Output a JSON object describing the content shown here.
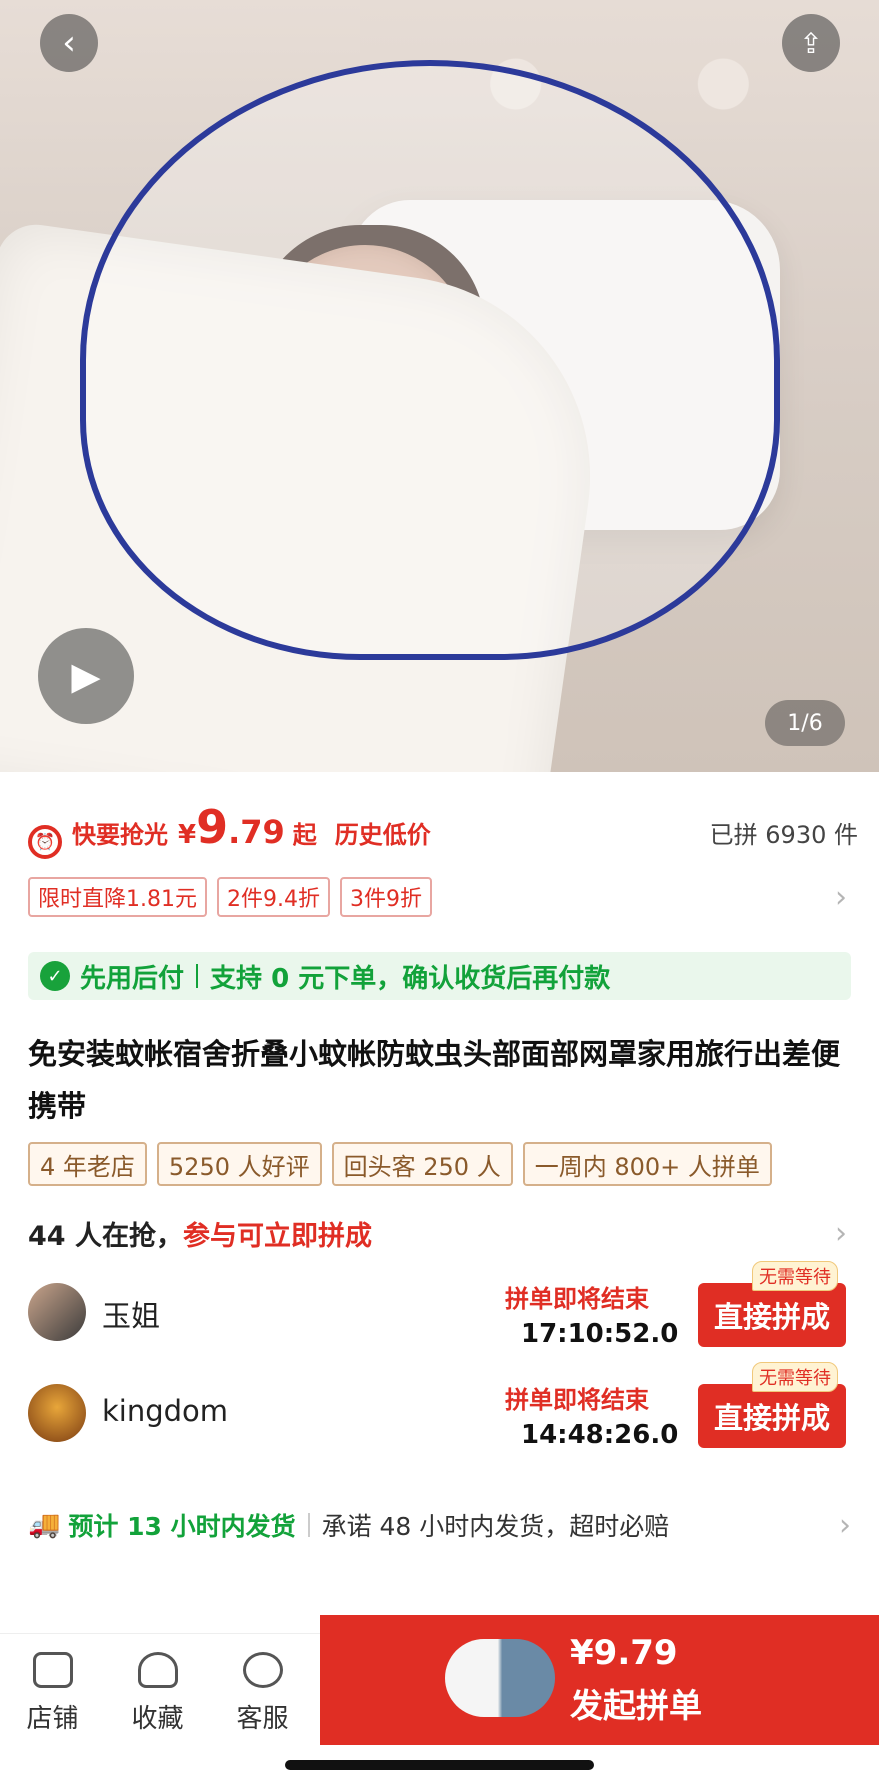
{
  "hero": {
    "pager": "1/6",
    "back_icon": "chevron-left-icon",
    "share_icon": "share-icon",
    "play_icon": "play-icon"
  },
  "price": {
    "flash_label": "快要抢光",
    "currency": "¥",
    "integer": "9",
    "decimal": ".79",
    "suffix": "起",
    "lowest_label": "历史低价",
    "sold": "已拼 6930 件"
  },
  "promo_tags": [
    "限时直降1.81元",
    "2件9.4折",
    "3件9折"
  ],
  "credit": {
    "label": "先用后付",
    "desc": "支持 0 元下单，确认收货后再付款"
  },
  "product_title": "免安装蚊帐宿舍折叠小蚊帐防蚊虫头部面部网罩家用旅行出差便携带",
  "shop_tags": [
    "4 年老店",
    "5250 人好评",
    "回头客 250 人",
    "一周内 800+ 人拼单"
  ],
  "group": {
    "count_text": "44 人在抢，",
    "cta_text": "参与可立即拼成",
    "items": [
      {
        "name": "玉姐",
        "end_label": "拼单即将结束",
        "time": "17:10:52.0",
        "badge": "无需等待",
        "button": "直接拼成"
      },
      {
        "name": "kingdom",
        "end_label": "拼单即将结束",
        "time": "14:48:26.0",
        "badge": "无需等待",
        "button": "直接拼成"
      }
    ]
  },
  "shipping": {
    "main": "预计 13 小时内发货",
    "promise": "承诺 48 小时内发货，超时必赔"
  },
  "bottom_nav": [
    {
      "label": "店铺",
      "icon": "store-icon"
    },
    {
      "label": "收藏",
      "icon": "heart-icon"
    },
    {
      "label": "客服",
      "icon": "chat-icon"
    }
  ],
  "buy": {
    "price": "¥9.79",
    "label": "发起拼单"
  },
  "colors": {
    "accent": "#e02e24",
    "green": "#12a23a",
    "brown": "#8a5a2b"
  }
}
